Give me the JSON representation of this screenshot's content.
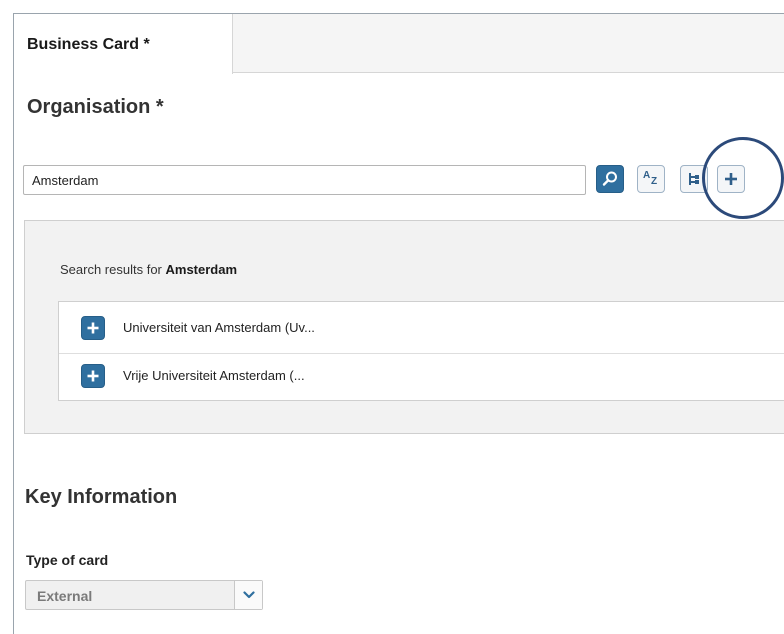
{
  "tab": {
    "label": "Business Card *"
  },
  "organisation": {
    "title": "Organisation *",
    "search_value": "Amsterdam"
  },
  "toolbar": {
    "search_icon": "magnifier-icon",
    "az_icon": "sort-az-icon",
    "az_a": "A",
    "az_z": "Z",
    "tree_icon": "hierarchy-icon",
    "add_icon": "plus-icon"
  },
  "results": {
    "caption_prefix": "Search results for ",
    "caption_term": "Amsterdam",
    "items": [
      {
        "label": "Universiteit van Amsterdam (Uv..."
      },
      {
        "label": "Vrije Universiteit Amsterdam (..."
      }
    ]
  },
  "key_information": {
    "title": "Key Information",
    "type_of_card_label": "Type of card",
    "type_of_card_value": "External"
  },
  "colors": {
    "accent": "#2f6f9f",
    "highlight_ring": "#2c4a7a"
  }
}
